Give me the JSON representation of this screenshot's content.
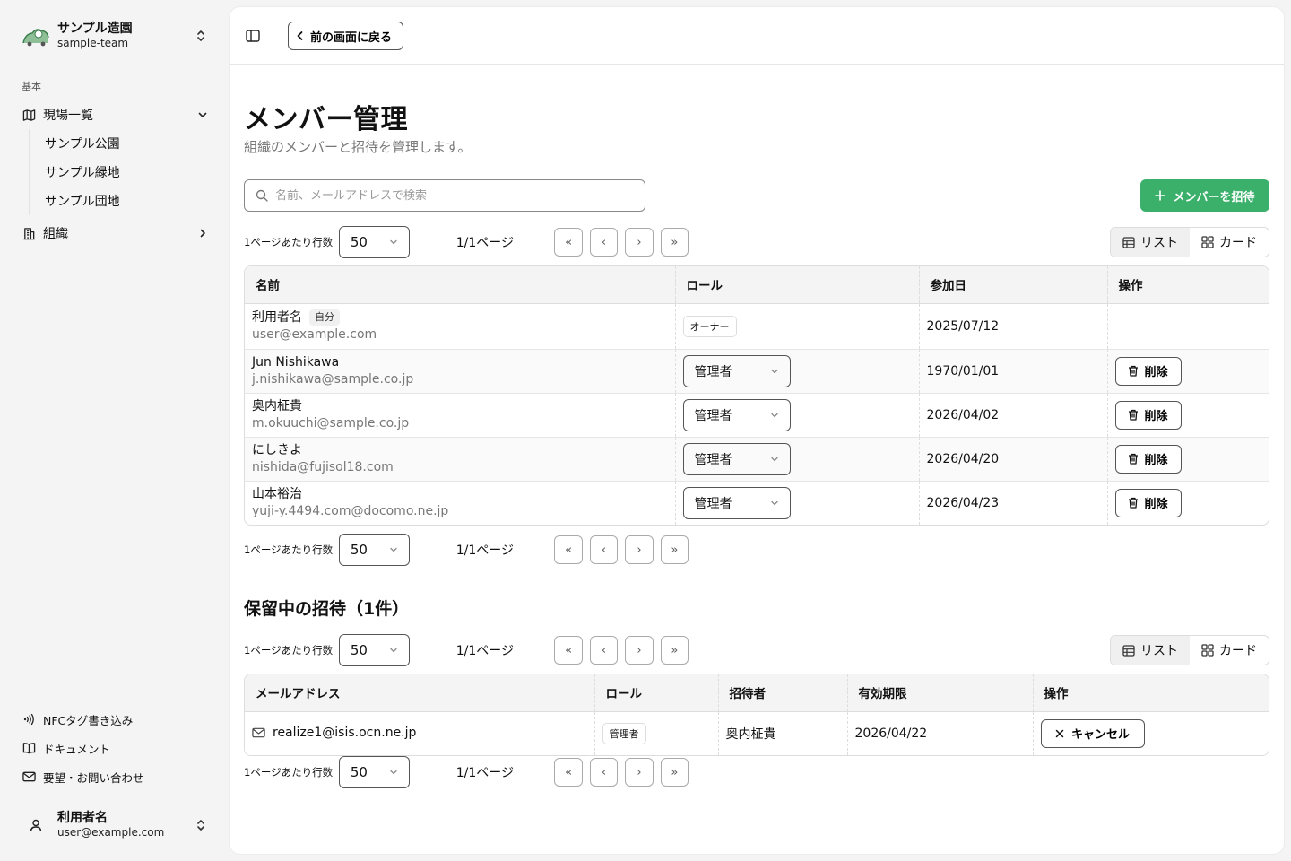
{
  "team": {
    "name": "サンプル造園",
    "slug": "sample-team"
  },
  "sidebar": {
    "section_label": "基本",
    "sites": {
      "label": "現場一覧",
      "children": [
        "サンプル公園",
        "サンプル緑地",
        "サンプル団地"
      ]
    },
    "org": {
      "label": "組織"
    },
    "footer": [
      {
        "label": "NFCタグ書き込み",
        "icon": "nfc-icon"
      },
      {
        "label": "ドキュメント",
        "icon": "book-icon"
      },
      {
        "label": "要望・お問い合わせ",
        "icon": "mail-icon"
      }
    ]
  },
  "user": {
    "name": "利用者名",
    "email": "user@example.com"
  },
  "topbar": {
    "back_label": "前の画面に戻る"
  },
  "page": {
    "title": "メンバー管理",
    "description": "組織のメンバーと招待を管理します。"
  },
  "search": {
    "placeholder": "名前、メールアドレスで検索"
  },
  "invite_label": "メンバーを招待",
  "pagination": {
    "rows_label": "1ページあたり行数",
    "rows_value": "50",
    "page_info": "1/1ページ"
  },
  "view_toggle": {
    "list": "リスト",
    "card": "カード"
  },
  "members": {
    "columns": [
      "名前",
      "ロール",
      "参加日",
      "操作"
    ],
    "self_badge": "自分",
    "owner_badge": "オーナー",
    "delete_label": "削除",
    "rows": [
      {
        "name": "利用者名",
        "email": "user@example.com",
        "role": "オーナー",
        "joined": "2025/07/12"
      },
      {
        "name": "Jun Nishikawa",
        "email": "j.nishikawa@sample.co.jp",
        "role": "管理者",
        "joined": "1970/01/01"
      },
      {
        "name": "奥内柾貴",
        "email": "m.okuuchi@sample.co.jp",
        "role": "管理者",
        "joined": "2026/04/02"
      },
      {
        "name": "にしきよ",
        "email": "nishida@fujisol18.com",
        "role": "管理者",
        "joined": "2026/04/20"
      },
      {
        "name": "山本裕治",
        "email": "yuji-y.4494.com@docomo.ne.jp",
        "role": "管理者",
        "joined": "2026/04/23"
      }
    ]
  },
  "invites": {
    "title": "保留中の招待（1件）",
    "columns": [
      "メールアドレス",
      "ロール",
      "招待者",
      "有効期限",
      "操作"
    ],
    "cancel_label": "キャンセル",
    "rows": [
      {
        "email": "realize1@isis.ocn.ne.jp",
        "role": "管理者",
        "inviter": "奥内柾貴",
        "expires": "2026/04/22"
      }
    ]
  }
}
